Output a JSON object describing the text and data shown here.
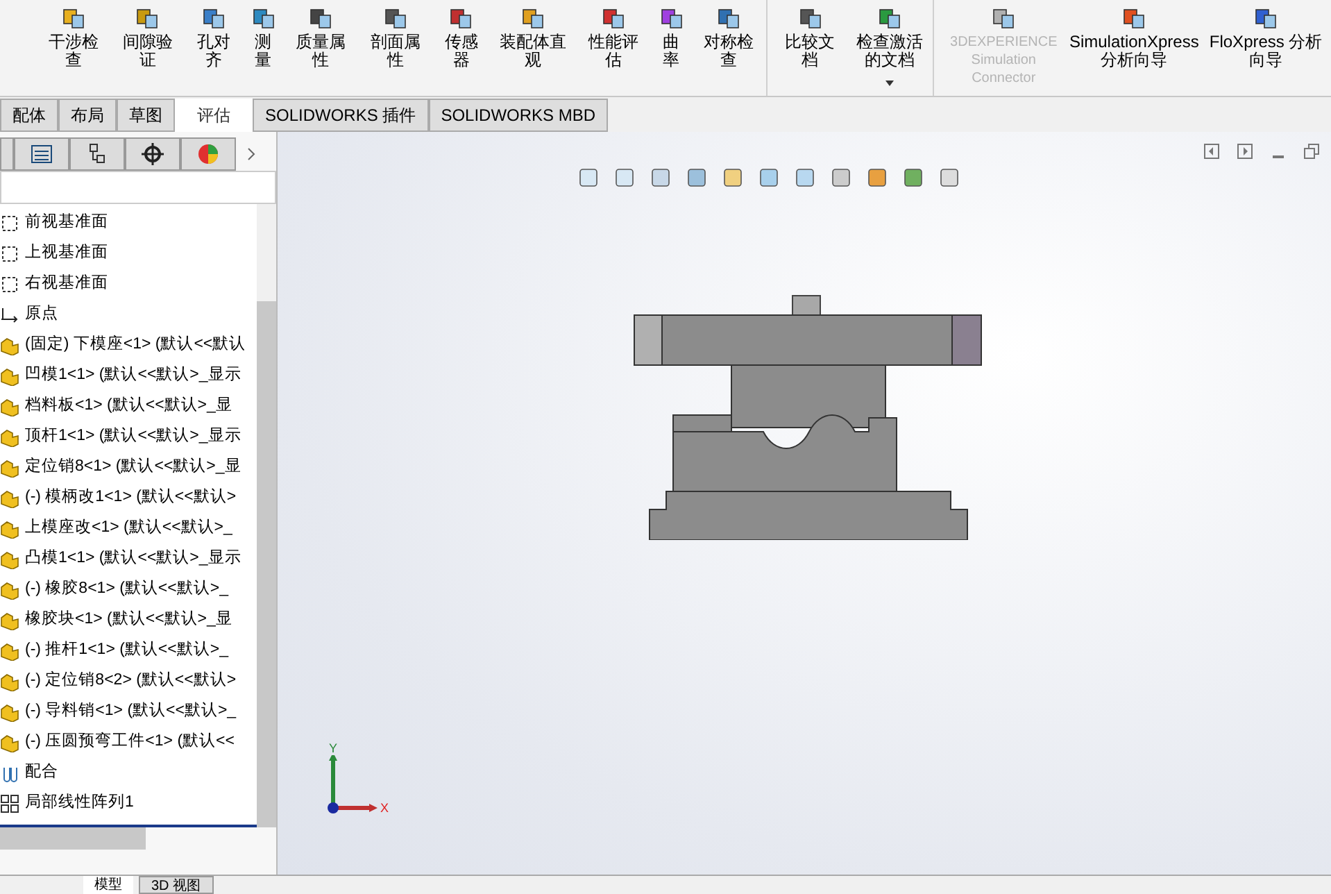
{
  "toolbar": {
    "groups": [
      {
        "items": [
          {
            "label": "干涉检查"
          },
          {
            "label": "间隙验证"
          },
          {
            "label": "孔对齐"
          },
          {
            "label": "测量"
          },
          {
            "label": "质量属性"
          },
          {
            "label": "剖面属性"
          },
          {
            "label": "传感器"
          },
          {
            "label": "装配体直观"
          },
          {
            "label": "性能评估"
          },
          {
            "label": "曲率"
          },
          {
            "label": "对称检查"
          }
        ]
      },
      {
        "items": [
          {
            "label": "比较文档",
            "dropdown": false
          },
          {
            "label": "检查激活的文档",
            "dropdown": true
          }
        ]
      },
      {
        "items": [
          {
            "label": "3DEXPERIENCE Simulation Connector",
            "disabled": true
          },
          {
            "label": "SimulationXpress 分析向导",
            "disabled": false
          },
          {
            "label": "FloXpress 分析向导",
            "disabled": false
          }
        ]
      }
    ]
  },
  "tabs": [
    {
      "label": "配体",
      "selected": false
    },
    {
      "label": "布局",
      "selected": false
    },
    {
      "label": "草图",
      "selected": false
    },
    {
      "label": "评估",
      "selected": true
    },
    {
      "label": "SOLIDWORKS 插件",
      "selected": false
    },
    {
      "label": "SOLIDWORKS MBD",
      "selected": false
    }
  ],
  "tree": {
    "items": [
      {
        "kind": "plane",
        "label": "前视基准面"
      },
      {
        "kind": "plane",
        "label": "上视基准面"
      },
      {
        "kind": "plane",
        "label": "右视基准面"
      },
      {
        "kind": "origin",
        "label": "原点"
      },
      {
        "kind": "part",
        "label": "(固定) 下模座<1> (默认<<默认"
      },
      {
        "kind": "part",
        "label": "凹模1<1> (默认<<默认>_显示"
      },
      {
        "kind": "part",
        "label": "档料板<1> (默认<<默认>_显"
      },
      {
        "kind": "part",
        "label": "顶杆1<1> (默认<<默认>_显示"
      },
      {
        "kind": "part",
        "label": "定位销8<1> (默认<<默认>_显"
      },
      {
        "kind": "part",
        "label": "(-) 模柄改1<1> (默认<<默认>"
      },
      {
        "kind": "part",
        "label": "上模座改<1> (默认<<默认>_"
      },
      {
        "kind": "part",
        "label": "凸模1<1> (默认<<默认>_显示"
      },
      {
        "kind": "part",
        "label": "(-) 橡胶8<1> (默认<<默认>_"
      },
      {
        "kind": "part",
        "label": "橡胶块<1> (默认<<默认>_显"
      },
      {
        "kind": "part",
        "label": "(-) 推杆1<1> (默认<<默认>_"
      },
      {
        "kind": "part",
        "label": "(-) 定位销8<2> (默认<<默认>"
      },
      {
        "kind": "part",
        "label": "(-) 导料销<1> (默认<<默认>_"
      },
      {
        "kind": "part",
        "label": "(-) 压圆预弯工件<1> (默认<<"
      },
      {
        "kind": "mates",
        "label": "配合"
      },
      {
        "kind": "pattern",
        "label": "局部线性阵列1"
      }
    ]
  },
  "triad": {
    "x": "X",
    "y": "Y"
  },
  "bottom_tabs": [
    {
      "label": "模型",
      "selected": true
    },
    {
      "label": "3D 视图",
      "selected": false
    }
  ]
}
